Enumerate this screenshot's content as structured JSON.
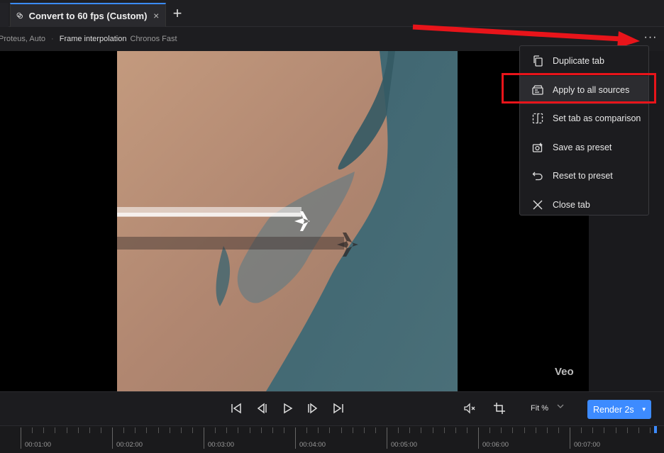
{
  "tab": {
    "title": "Convert to 60 fps (Custom)",
    "close": "×",
    "new_tab": "+"
  },
  "settings_strip": {
    "enhance_value": "Proteus, Auto",
    "separator": "·",
    "interp_key": "Frame interpolation",
    "interp_value": "Chronos Fast"
  },
  "more_button": "···",
  "viewer": {
    "watermark": "Veo"
  },
  "menu": {
    "items": [
      {
        "label": "Duplicate tab",
        "icon": "duplicate-icon"
      },
      {
        "label": "Apply to all sources",
        "icon": "apply-all-icon",
        "highlighted": true
      },
      {
        "label": "Set tab as comparison",
        "icon": "comparison-icon"
      },
      {
        "label": "Save as preset",
        "icon": "save-preset-icon"
      },
      {
        "label": "Reset to preset",
        "icon": "reset-icon"
      },
      {
        "label": "Close tab",
        "icon": "close-icon"
      }
    ]
  },
  "controls": {
    "fit_label": "Fit %",
    "render_label": "Render 2s"
  },
  "timeline": {
    "labels": [
      "00:01:00",
      "00:02:00",
      "00:03:00",
      "00:04:00",
      "00:05:00",
      "00:06:00",
      "00:07:00"
    ]
  },
  "colors": {
    "accent": "#3d8bff",
    "annotation_red": "#e8141a"
  }
}
